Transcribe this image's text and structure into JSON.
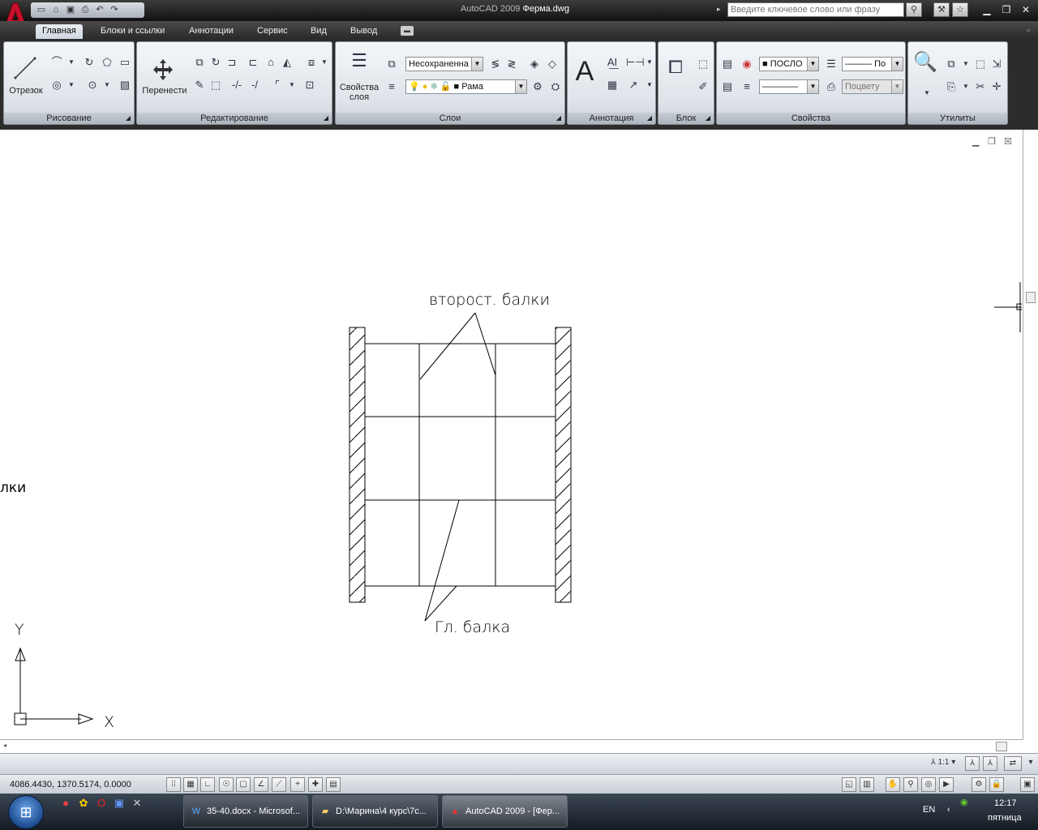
{
  "title": {
    "app": "AutoCAD 2009",
    "file": "Ферма.dwg"
  },
  "search": {
    "placeholder": "Введите ключевое слово или фразу"
  },
  "tabs": [
    "Главная",
    "Блоки и ссылки",
    "Аннотации",
    "Сервис",
    "Вид",
    "Вывод"
  ],
  "active_tab": "Главная",
  "panels": {
    "draw": {
      "title": "Рисование",
      "line_label": "Отрезок"
    },
    "modify": {
      "title": "Редактирование",
      "move_label": "Перенести"
    },
    "layers": {
      "title": "Слои",
      "props_label_1": "Свойства",
      "props_label_2": "слоя",
      "layer_state": "Несохраненна",
      "current_layer": "Рама"
    },
    "annotation": {
      "title": "Аннотация",
      "text_icon": "A"
    },
    "block": {
      "title": "Блок"
    },
    "properties": {
      "title": "Свойства",
      "color": "ПОСЛО",
      "linetype": "По",
      "lineweight": "",
      "plotstyle": "Поцвету"
    },
    "utilities": {
      "title": "Утилиты"
    }
  },
  "drawing": {
    "label_secondary": "второст. балки",
    "label_main": "Гл. балка",
    "label_cut": "лки",
    "ucs_x": "X",
    "ucs_y": "Y"
  },
  "status": {
    "coords": "4086.4430, 1370.5174, 0.0000",
    "scale": "1:1"
  },
  "taskbar": {
    "tasks": [
      "35-40.docx - Microsof...",
      "D:\\Марина\\4 курс\\7с...",
      "AutoCAD 2009 - [Фер..."
    ],
    "lang": "EN",
    "time": "12:17",
    "day": "пятница"
  },
  "colors": {
    "accent": "#c00000",
    "canvas": "#ffffff"
  }
}
